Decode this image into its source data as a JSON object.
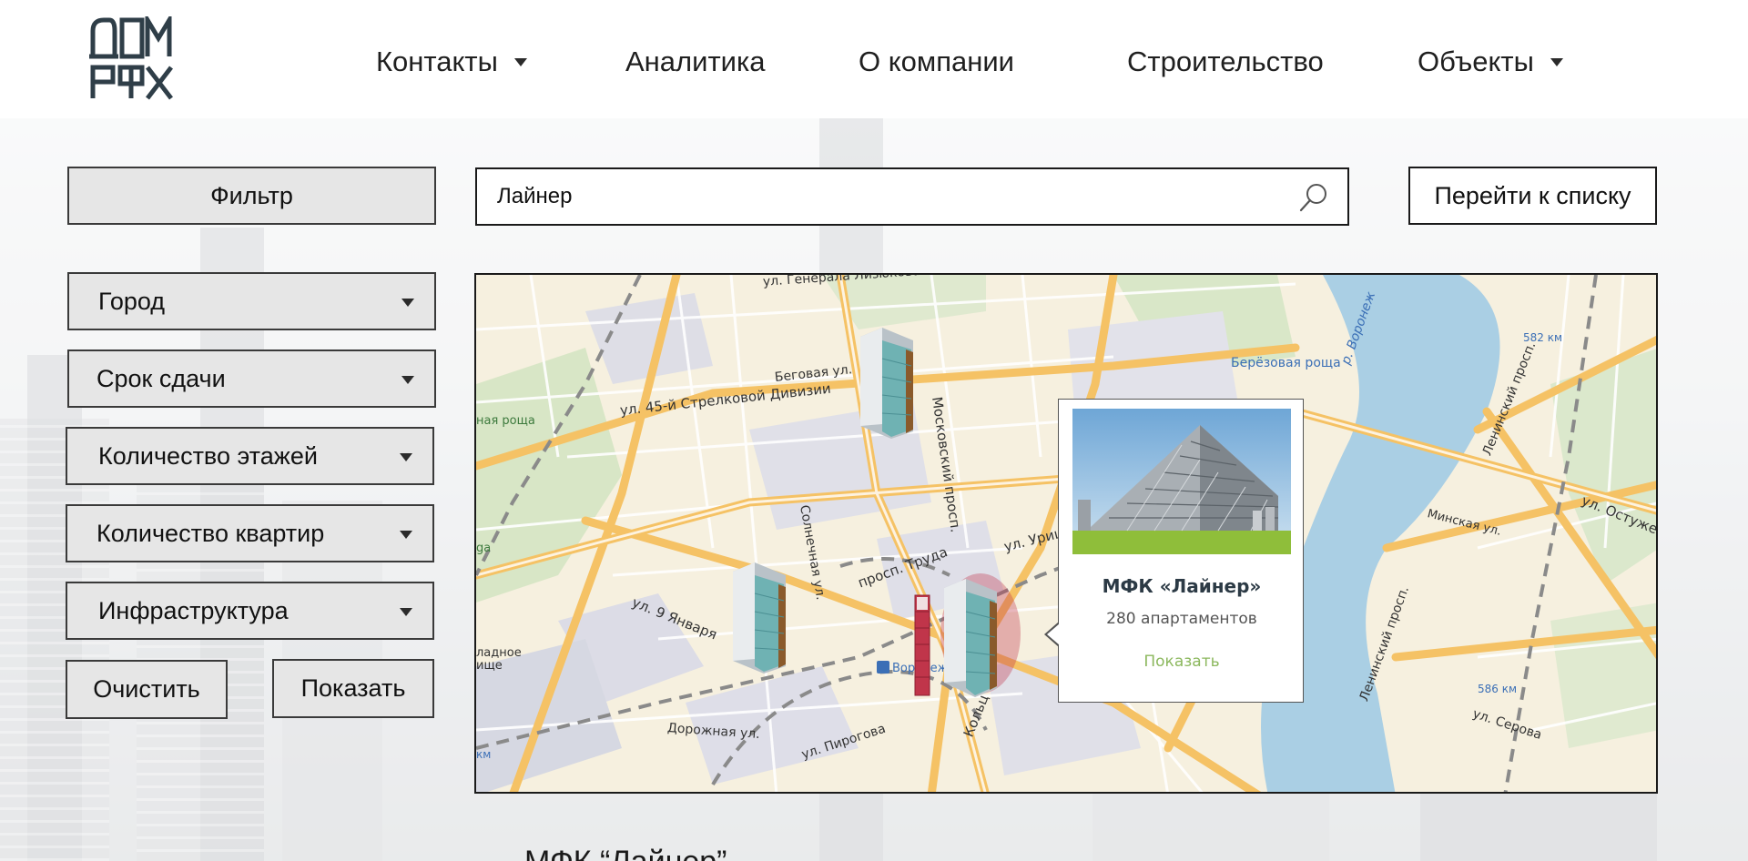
{
  "header": {
    "nav": [
      {
        "label": "Контакты",
        "has_dropdown": true
      },
      {
        "label": "Аналитика",
        "has_dropdown": false
      },
      {
        "label": "О компании",
        "has_dropdown": false
      },
      {
        "label": "Строительство",
        "has_dropdown": false
      },
      {
        "label": "Объекты",
        "has_dropdown": true
      }
    ]
  },
  "sidebar": {
    "filter_label": "Фильтр",
    "selects": [
      {
        "label": "Город"
      },
      {
        "label": "Срок сдачи"
      },
      {
        "label": "Количество этажей"
      },
      {
        "label": "Количество квартир"
      },
      {
        "label": "Инфраструктура"
      }
    ],
    "clear_label": "Очистить",
    "show_label": "Показать"
  },
  "search": {
    "value": "Лайнер",
    "list_button_label": "Перейти к списку"
  },
  "map": {
    "labels": {
      "general_lizyukova": "ул. Генерала Лизюкова",
      "begovaya": "Беговая ул.",
      "strelkovoy": "ул. 45-й Стрелковой Дивизии",
      "moskovsky": "Московский просп.",
      "solnechnaya": "Солнечная ул.",
      "truda": "просп. Труда",
      "yanvarya": "ул. 9 Января",
      "dorozhnaya": "Дорожная ул.",
      "pirogova": "ул. Пирогова",
      "kolcevaya": "Кольц",
      "uricko": "ул. Урицко",
      "voronezh_station": "Воронеж-К",
      "berezovaya": "Берёзовая роща",
      "river": "р. Воронеж",
      "km582": "582 км",
      "km586": "586 км",
      "leninsky1": "Ленинский просп.",
      "leninsky2": "Ленинский просп.",
      "ostuzheva": "ул. Остужева",
      "minskaya": "Минская ул.",
      "serova": "ул. Серова",
      "roshcha": "ная роща",
      "zapadnoe": "ладное",
      "kladb": "ище",
      "km_left": "км",
      "ga": "ga"
    },
    "popup": {
      "title": "МФК «Лайнер»",
      "subtitle": "280 апартаментов",
      "link": "Показать"
    }
  },
  "result": {
    "title": "МФК “Лайнер”"
  },
  "colors": {
    "accent_green": "#8cb85e",
    "marker_highlight": "#c0354a",
    "logo": "#2f3e48"
  }
}
